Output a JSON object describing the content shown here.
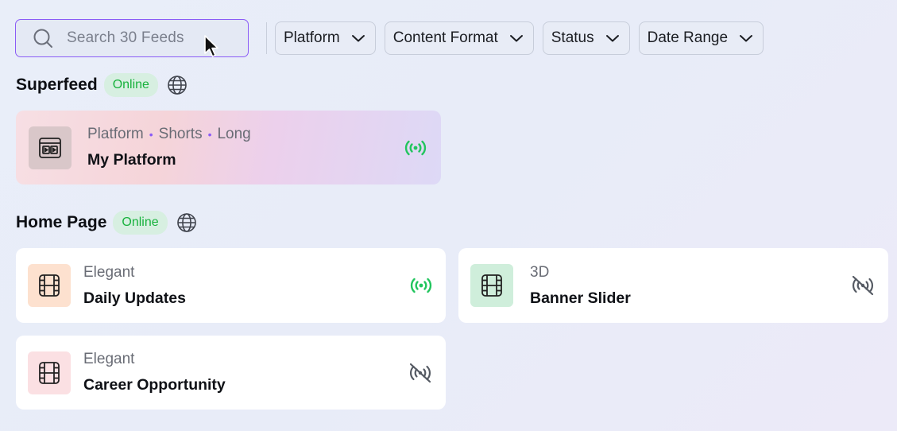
{
  "search": {
    "placeholder": "Search 30 Feeds"
  },
  "filters": [
    {
      "label": "Platform"
    },
    {
      "label": "Content Format"
    },
    {
      "label": "Status"
    },
    {
      "label": "Date Range"
    }
  ],
  "superfeed": {
    "title": "Superfeed",
    "badge": "Online",
    "card": {
      "tags": [
        "Platform",
        "Shorts",
        "Long"
      ],
      "name": "My Platform",
      "status": "live"
    }
  },
  "home": {
    "title": "Home Page",
    "badge": "Online",
    "cards": [
      {
        "sub": "Elegant",
        "name": "Daily Updates",
        "thumb_color": "#fde1cf",
        "status": "live"
      },
      {
        "sub": "3D",
        "name": "Banner Slider",
        "thumb_color": "#cfeedb",
        "status": "offline"
      },
      {
        "sub": "Elegant",
        "name": "Career Opportunity",
        "thumb_color": "#fbe0e3",
        "status": "offline"
      }
    ]
  },
  "colors": {
    "accent": "#8b5cf6",
    "online_text": "#18b23d",
    "online_bg": "#d7efe1",
    "live_icon": "#22c55e",
    "offline_icon": "#555a63"
  },
  "icons": {
    "search": "search-icon",
    "chevron": "chevron-down-icon",
    "globe": "globe-icon",
    "live": "broadcast-icon",
    "offline": "broadcast-off-icon",
    "film": "film-icon",
    "layout": "layout-icon",
    "cursor": "cursor-icon"
  }
}
